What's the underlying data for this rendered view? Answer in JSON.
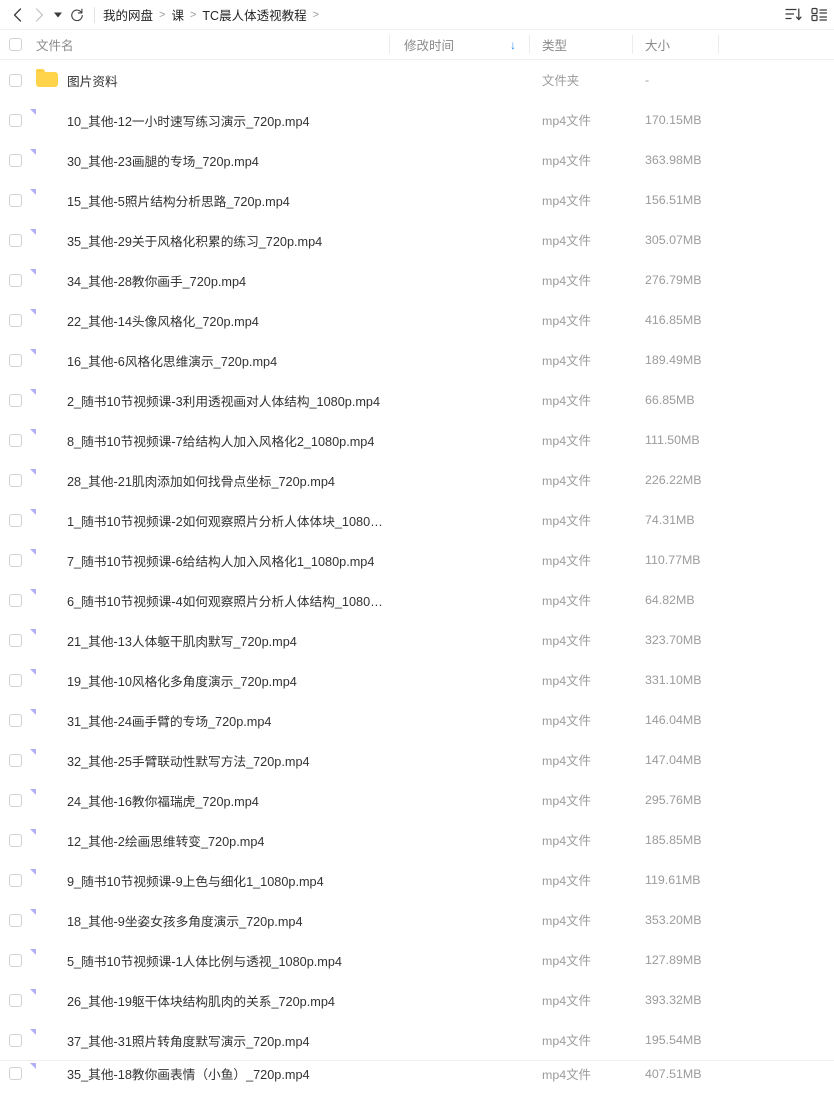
{
  "toolbar": {
    "back_icon": "chevron-left-icon",
    "forward_icon": "chevron-right-icon",
    "history_icon": "caret-down-icon",
    "refresh_icon": "refresh-icon",
    "sort_icon": "sort-list-icon",
    "view_icon": "grid-view-icon"
  },
  "breadcrumb": {
    "items": [
      "我的网盘",
      "课",
      "TC晨人体透视教程"
    ],
    "separator": ">",
    "trailing_separator": ">"
  },
  "columns": {
    "name": "文件名",
    "time": "修改时间",
    "type": "类型",
    "size": "大小",
    "sort_direction_icon": "arrow-down-icon"
  },
  "files": [
    {
      "name": "图片资料",
      "type": "文件夹",
      "size": "-",
      "kind": "folder"
    },
    {
      "name": "10_其他-12一小时速写练习演示_720p.mp4",
      "type": "mp4文件",
      "size": "170.15MB",
      "kind": "video"
    },
    {
      "name": "30_其他-23画腿的专场_720p.mp4",
      "type": "mp4文件",
      "size": "363.98MB",
      "kind": "video"
    },
    {
      "name": "15_其他-5照片结构分析思路_720p.mp4",
      "type": "mp4文件",
      "size": "156.51MB",
      "kind": "video"
    },
    {
      "name": "35_其他-29关于风格化积累的练习_720p.mp4",
      "type": "mp4文件",
      "size": "305.07MB",
      "kind": "video"
    },
    {
      "name": "34_其他-28教你画手_720p.mp4",
      "type": "mp4文件",
      "size": "276.79MB",
      "kind": "video"
    },
    {
      "name": "22_其他-14头像风格化_720p.mp4",
      "type": "mp4文件",
      "size": "416.85MB",
      "kind": "video"
    },
    {
      "name": "16_其他-6风格化思维演示_720p.mp4",
      "type": "mp4文件",
      "size": "189.49MB",
      "kind": "video"
    },
    {
      "name": "2_随书10节视频课-3利用透视画对人体结构_1080p.mp4",
      "type": "mp4文件",
      "size": "66.85MB",
      "kind": "video"
    },
    {
      "name": "8_随书10节视频课-7给结构人加入风格化2_1080p.mp4",
      "type": "mp4文件",
      "size": "111.50MB",
      "kind": "video"
    },
    {
      "name": "28_其他-21肌肉添加如何找骨点坐标_720p.mp4",
      "type": "mp4文件",
      "size": "226.22MB",
      "kind": "video"
    },
    {
      "name": "1_随书10节视频课-2如何观察照片分析人体体块_1080p....",
      "type": "mp4文件",
      "size": "74.31MB",
      "kind": "video"
    },
    {
      "name": "7_随书10节视频课-6给结构人加入风格化1_1080p.mp4",
      "type": "mp4文件",
      "size": "110.77MB",
      "kind": "video"
    },
    {
      "name": "6_随书10节视频课-4如何观察照片分析人体结构_1080p....",
      "type": "mp4文件",
      "size": "64.82MB",
      "kind": "video"
    },
    {
      "name": "21_其他-13人体躯干肌肉默写_720p.mp4",
      "type": "mp4文件",
      "size": "323.70MB",
      "kind": "video"
    },
    {
      "name": "19_其他-10风格化多角度演示_720p.mp4",
      "type": "mp4文件",
      "size": "331.10MB",
      "kind": "video"
    },
    {
      "name": "31_其他-24画手臂的专场_720p.mp4",
      "type": "mp4文件",
      "size": "146.04MB",
      "kind": "video"
    },
    {
      "name": "32_其他-25手臂联动性默写方法_720p.mp4",
      "type": "mp4文件",
      "size": "147.04MB",
      "kind": "video"
    },
    {
      "name": "24_其他-16教你福瑞虎_720p.mp4",
      "type": "mp4文件",
      "size": "295.76MB",
      "kind": "video"
    },
    {
      "name": "12_其他-2绘画思维转变_720p.mp4",
      "type": "mp4文件",
      "size": "185.85MB",
      "kind": "video"
    },
    {
      "name": "9_随书10节视频课-9上色与细化1_1080p.mp4",
      "type": "mp4文件",
      "size": "119.61MB",
      "kind": "video"
    },
    {
      "name": "18_其他-9坐姿女孩多角度演示_720p.mp4",
      "type": "mp4文件",
      "size": "353.20MB",
      "kind": "video"
    },
    {
      "name": "5_随书10节视频课-1人体比例与透视_1080p.mp4",
      "type": "mp4文件",
      "size": "127.89MB",
      "kind": "video"
    },
    {
      "name": "26_其他-19躯干体块结构肌肉的关系_720p.mp4",
      "type": "mp4文件",
      "size": "393.32MB",
      "kind": "video"
    },
    {
      "name": "37_其他-31照片转角度默写演示_720p.mp4",
      "type": "mp4文件",
      "size": "195.54MB",
      "kind": "video"
    },
    {
      "name": "35_其他-18教你画表情（小鱼）_720p.mp4",
      "type": "mp4文件",
      "size": "407.51MB",
      "kind": "video"
    }
  ]
}
